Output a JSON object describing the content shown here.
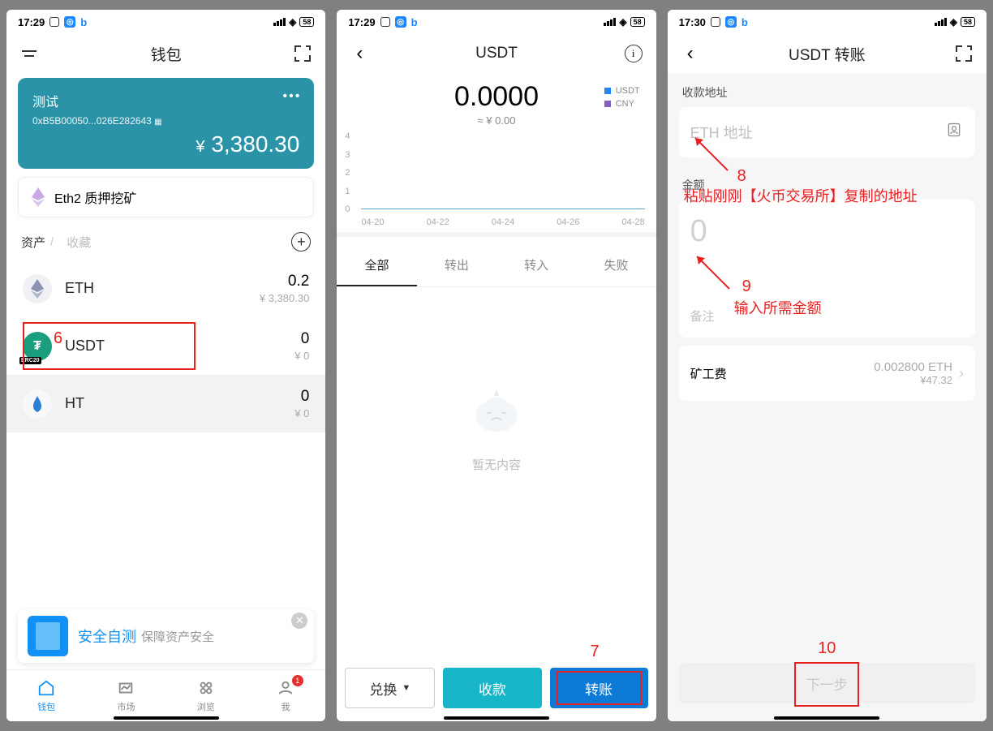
{
  "status_time_a": "17:29",
  "status_time_b": "17:30",
  "status_battery": "58",
  "screen1": {
    "title": "钱包",
    "wallet_name": "测试",
    "wallet_addr": "0xB5B00050...026E282643",
    "balance": "3,380.30",
    "staking_label": "Eth2 质押挖矿",
    "tab_assets": "资产",
    "tab_fav": "收藏",
    "assets": [
      {
        "sym": "ETH",
        "amount": "0.2",
        "fiat": "¥ 3,380.30"
      },
      {
        "sym": "USDT",
        "amount": "0",
        "fiat": "¥ 0",
        "badge": "ERC20"
      },
      {
        "sym": "HT",
        "amount": "0",
        "fiat": "¥ 0"
      }
    ],
    "banner_title": "安全自测",
    "banner_sub": "保障资产安全",
    "tabs": [
      "钱包",
      "市场",
      "浏览",
      "我"
    ],
    "badge_count": "1",
    "anno_6": "6"
  },
  "screen2": {
    "title": "USDT",
    "balance": "0.0000",
    "balance_sub": "≈ ¥ 0.00",
    "legend": [
      "USDT",
      "CNY"
    ],
    "y_ticks": [
      "4",
      "3",
      "2",
      "1",
      "0"
    ],
    "x_ticks": [
      "04-20",
      "04-22",
      "04-24",
      "04-26",
      "04-28"
    ],
    "tx_tabs": [
      "全部",
      "转出",
      "转入",
      "失败"
    ],
    "empty_text": "暂无内容",
    "btn_exchange": "兑换",
    "btn_receive": "收款",
    "btn_send": "转账",
    "anno_7": "7"
  },
  "screen3": {
    "title": "USDT 转账",
    "label_addr": "收款地址",
    "placeholder_addr": "ETH 地址",
    "label_amount": "金额",
    "placeholder_amount": "0",
    "placeholder_remark": "备注",
    "label_fee": "矿工费",
    "fee_main": "0.002800 ETH",
    "fee_sub": "¥47.32",
    "btn_next": "下一步",
    "anno_8_num": "8",
    "anno_8_txt": "粘贴刚刚【火币交易所】复制的地址",
    "anno_9_num": "9",
    "anno_9_txt": "输入所需金额",
    "anno_10": "10"
  },
  "chart_data": {
    "type": "line",
    "x": [
      "04-20",
      "04-22",
      "04-24",
      "04-26",
      "04-28"
    ],
    "series": [
      {
        "name": "USDT",
        "values": [
          0,
          0,
          0,
          0,
          0
        ]
      },
      {
        "name": "CNY",
        "values": [
          0,
          0,
          0,
          0,
          0
        ]
      }
    ],
    "ylim": [
      0,
      4
    ],
    "y_ticks": [
      0,
      1,
      2,
      3,
      4
    ]
  }
}
